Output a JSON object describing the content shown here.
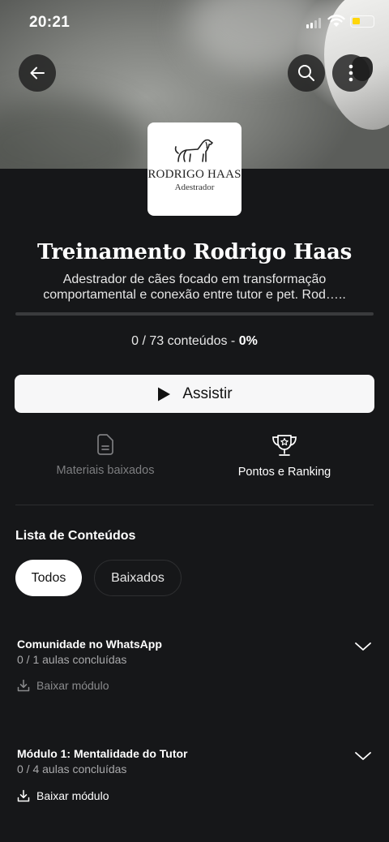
{
  "status_bar": {
    "time": "20:21"
  },
  "course": {
    "logo_name": "RODRIGO HAAS",
    "logo_subtitle": "Adestrador",
    "title": "Treinamento Rodrigo Haas",
    "description_line1": "Adestrador de cães focado em transformação",
    "description_line2": "comportamental e conexão entre tutor e pet. Rod…..",
    "progress_fraction": 0.0,
    "progress_count": "0 / 73 conteúdos - ",
    "progress_percent": "0%"
  },
  "actions": {
    "watch_label": "Assistir"
  },
  "shortcuts": [
    {
      "label": "Materiais baixados",
      "icon": "file-icon",
      "enabled": false
    },
    {
      "label": "Pontos e Ranking",
      "icon": "trophy-icon",
      "enabled": true
    }
  ],
  "content_list": {
    "title": "Lista de Conteúdos",
    "filters": [
      {
        "label": "Todos",
        "active": true
      },
      {
        "label": "Baixados",
        "active": false
      }
    ],
    "modules": [
      {
        "name": "Comunidade no WhatsApp",
        "progress": "0 / 1 aulas concluídas",
        "download_label": "Baixar módulo",
        "download_enabled": false
      },
      {
        "name": "Módulo 1: Mentalidade do Tutor",
        "progress": "0 / 4 aulas concluídas",
        "download_label": "Baixar módulo",
        "download_enabled": true
      }
    ]
  },
  "colors": {
    "background": "#161719",
    "button": "#f7f7f8",
    "battery": "#ffd60a"
  }
}
